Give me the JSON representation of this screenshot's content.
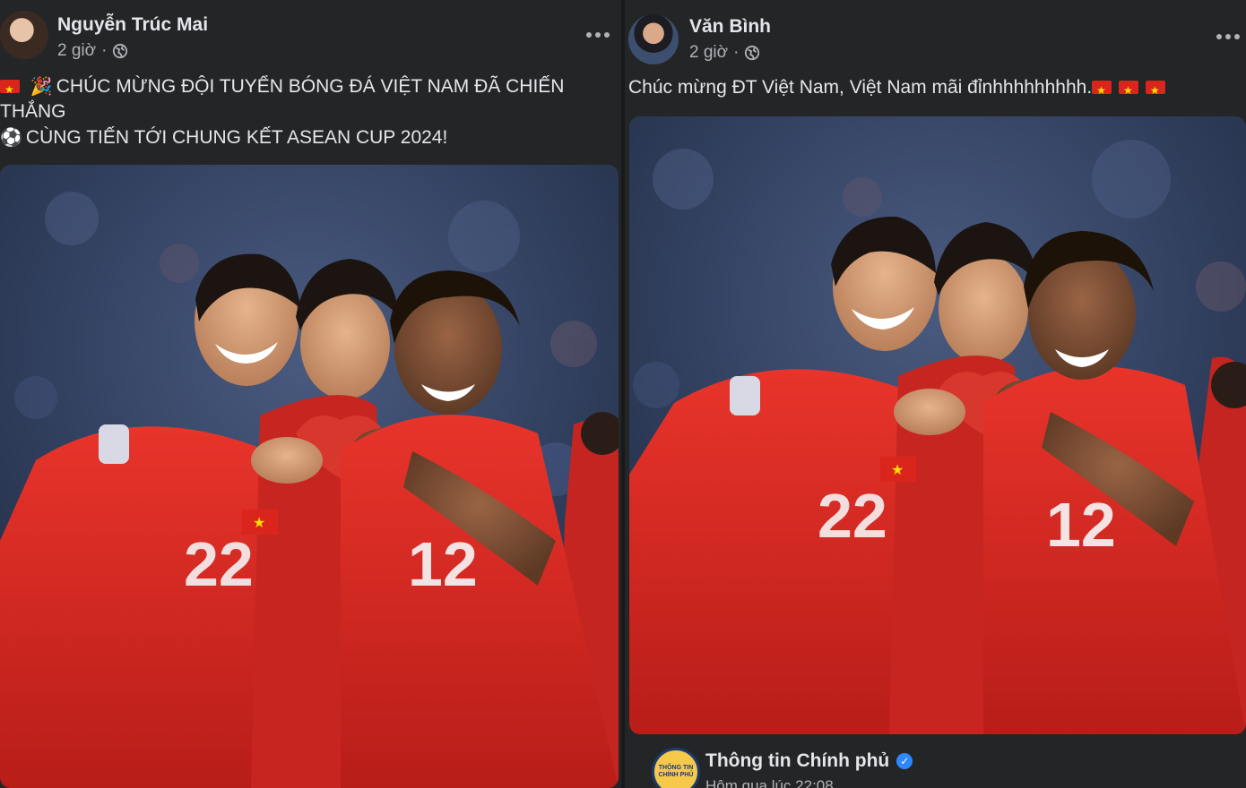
{
  "post1": {
    "author": "Nguyễn Trúc Mai",
    "time": "2 giờ",
    "separator": "·",
    "caption_line1": "CHÚC MỪNG ĐỘI TUYỂN BÓNG ĐÁ VIỆT NAM ĐÃ CHIẾN",
    "caption_line2": "THẮNG",
    "caption_line3": "CÙNG TIẾN TỚI CHUNG KẾT ASEAN CUP 2024!"
  },
  "post2": {
    "author": "Văn Bình",
    "time": "2 giờ",
    "separator": "·",
    "caption": "Chúc mừng ĐT Việt Nam, Việt Nam mãi đỉnhhhhhhhhh.",
    "shared_page": {
      "name": "Thông tin Chính phủ",
      "time": "Hôm qua lúc 22:08",
      "logo_text": "THÔNG TIN CHÍNH PHỦ"
    }
  },
  "photo": {
    "jersey_number": "12",
    "jersey_number_left": "22"
  },
  "colors": {
    "background": "#242526",
    "text_primary": "#e4e6eb",
    "text_secondary": "#b0b3b8",
    "jersey_red": "#d8251f",
    "stadium_blue": "#34456a",
    "verified_blue": "#2d88ff"
  },
  "icons": {
    "privacy": "globe-icon",
    "menu": "more-options-icon",
    "flag": "vietnam-flag-emoji",
    "party": "party-popper-emoji",
    "ball": "soccer-ball-emoji",
    "verified": "verified-badge-icon"
  }
}
